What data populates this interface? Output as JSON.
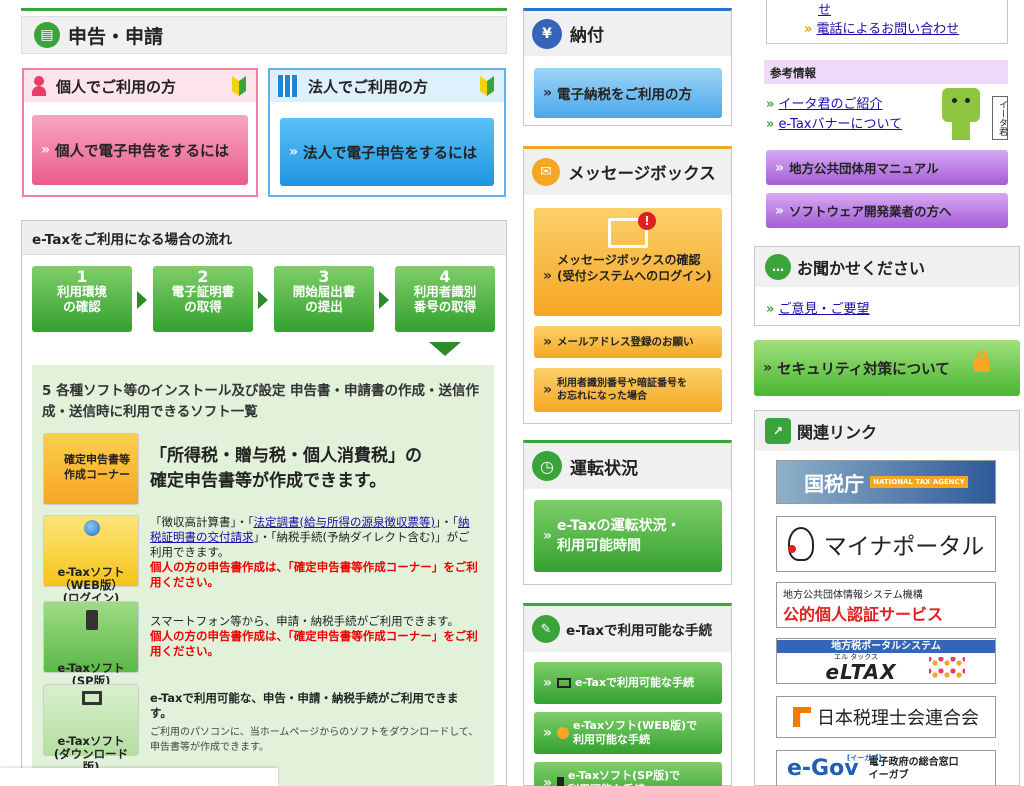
{
  "left": {
    "section_title": "申告・申請",
    "individual": {
      "label": "個人でご利用の方",
      "button": "個人で電子申告をするには"
    },
    "corporate": {
      "label": "法人でご利用の方",
      "button": "法人で電子申告をするには"
    },
    "flow": {
      "title": "e-Taxをご利用になる場合の流れ",
      "steps": [
        {
          "num": "1",
          "label": "利用環境\nの確認"
        },
        {
          "num": "2",
          "label": "電子証明書\nの取得"
        },
        {
          "num": "3",
          "label": "開始届出書\nの提出"
        },
        {
          "num": "4",
          "label": "利用者識別\n番号の取得"
        }
      ],
      "step5": "5 各種ソフト等のインストール及び設定  申告書・申請書の作成・送信作成・送信時に利用できるソフト一覧",
      "items": [
        {
          "icon": "確定申告書等\n作成コーナー",
          "headline": "「所得税・贈与税・個人消費税」の\n確定申告書等が作成できます。"
        },
        {
          "icon": "e-Taxソフト\n（WEB版）\n(ログイン)",
          "text_pre": "「徴収高計算書」・「",
          "link1": "法定調書(給与所得の源泉徴収票等)",
          "text_mid": "」・「",
          "link2": "納税証明書の交付請求",
          "text_post": "」・「納税手続(予納ダイレクト含む)」がご利用できます。",
          "red": "個人の方の申告書作成は、「確定申告書等作成コーナー」をご利用ください。"
        },
        {
          "icon": "e-Taxソフト\n(SP版)",
          "text": "スマートフォン等から、申請・納税手続がご利用できます。",
          "red": "個人の方の申告書作成は、「確定申告書等作成コーナー」をご利用ください。"
        },
        {
          "icon": "e-Taxソフト\n(ダウンロード\n版)",
          "text": "e-Taxで利用可能な、申告・申請・納税手続がご利用できます。",
          "small": "ご利用のパソコンに、当ホームページからのソフトをダウンロードして、申告書等が作成できます。"
        }
      ]
    }
  },
  "mid": {
    "payment": {
      "title": "納付",
      "button": "電子納税をご利用の方"
    },
    "messagebox": {
      "title": "メッセージボックス",
      "main": "メッセージボックスの確認\n(受付システムへのログイン)",
      "b1": "メールアドレス登録のお願い",
      "b2": "利用者識別番号や暗証番号を\nお忘れになった場合"
    },
    "status": {
      "title": "運転状況",
      "button": "e-Taxの運転状況・\n利用可能時間"
    },
    "procedures": {
      "title": "e-Taxで利用可能な手続",
      "b1": "e-Taxで利用可能な手続",
      "b2": "e-Taxソフト(WEB版)で\n利用可能な手続",
      "b3": "e-Taxソフト(SP版)で\n利用可能な手続"
    }
  },
  "right": {
    "top_link_partial": "せ",
    "phone_link": "電話によるお問い合わせ",
    "reference": {
      "title": "参考情報",
      "link1": "イータ君のご紹介",
      "link2": "e-Taxバナーについて",
      "mascot_tag": "イータ君"
    },
    "btn_local": "地方公共団体用マニュアル",
    "btn_dev": "ソフトウェア開発業者の方へ",
    "feedback": {
      "title": "お聞かせください",
      "link": "ご意見・ご要望"
    },
    "security": "セキュリティ対策について",
    "related": {
      "title": "関連リンク",
      "logos": [
        {
          "name": "国税庁",
          "sub": "NATIONAL TAX AGENCY"
        },
        {
          "name": "マイナポータル"
        },
        {
          "top": "地方公共団体情報システム機構",
          "name": "公的個人認証サービス"
        },
        {
          "top": "地方税ポータルシステム",
          "ruby": "エル タックス",
          "name": "eLTAX"
        },
        {
          "name": "日本税理士会連合会"
        },
        {
          "name": "e-Gov",
          "ruby": "[イーガブ]",
          "sub": "電子政府の総合窓口\nイーガブ"
        }
      ]
    }
  },
  "colors": {
    "green": "#3aa33a",
    "pink": "#f07fa6",
    "blue": "#5ab4ee",
    "orange": "#f5a623",
    "purple": "#b57be3",
    "gray": "#eeeeee"
  }
}
